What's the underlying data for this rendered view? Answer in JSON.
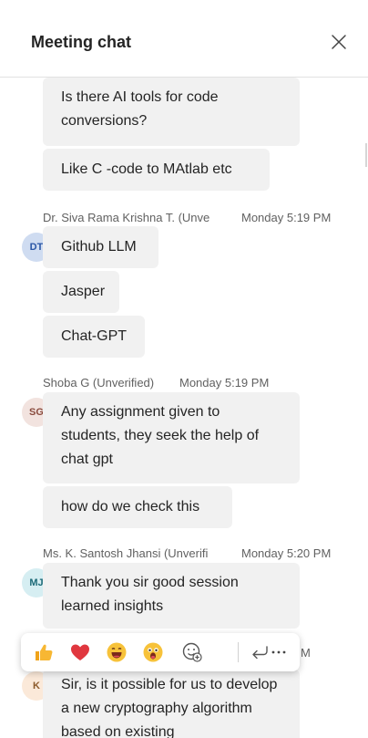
{
  "header": {
    "title": "Meeting chat"
  },
  "messages": {
    "m1": "Is there AI tools for code conversions?",
    "m2": "Like C -code to MAtlab etc",
    "s2_sender": "Dr. Siva Rama Krishna T. (Unve",
    "s2_time": "Monday 5:19 PM",
    "s2_avatar": "DT",
    "m3": "Github LLM",
    "m4": "Jasper",
    "m5": "Chat-GPT",
    "s3_sender": "Shoba G (Unverified)",
    "s3_time": "Monday 5:19 PM",
    "s3_avatar": "SG",
    "m6": "Any assignment given to students, they seek the help of chat gpt",
    "m7": "how do we check this",
    "s4_sender": "Ms. K. Santosh Jhansi (Unverifi",
    "s4_time": "Monday 5:20 PM",
    "s4_avatar": "MJ",
    "m8": "Thank you sir good session learned  insights",
    "s5_partial": "M",
    "s5_avatar": "K",
    "m9": "Sir, is it possible for us to develop a new cryptography algorithm based on existing"
  },
  "reactions": [
    "like-icon",
    "heart-icon",
    "laugh-icon",
    "surprised-icon",
    "add-reaction-icon",
    "reply-icon",
    "more-options-icon"
  ],
  "colors": {
    "avatar_dt_bg": "#cfdcf1",
    "avatar_dt_fg": "#2b57a6",
    "avatar_sg_bg": "#f2e3df",
    "avatar_sg_fg": "#8a4b3e",
    "avatar_mj_bg": "#d6eef2",
    "avatar_mj_fg": "#1c6a78",
    "avatar_k_bg": "#fbe9d9",
    "avatar_k_fg": "#8c5a2b"
  }
}
